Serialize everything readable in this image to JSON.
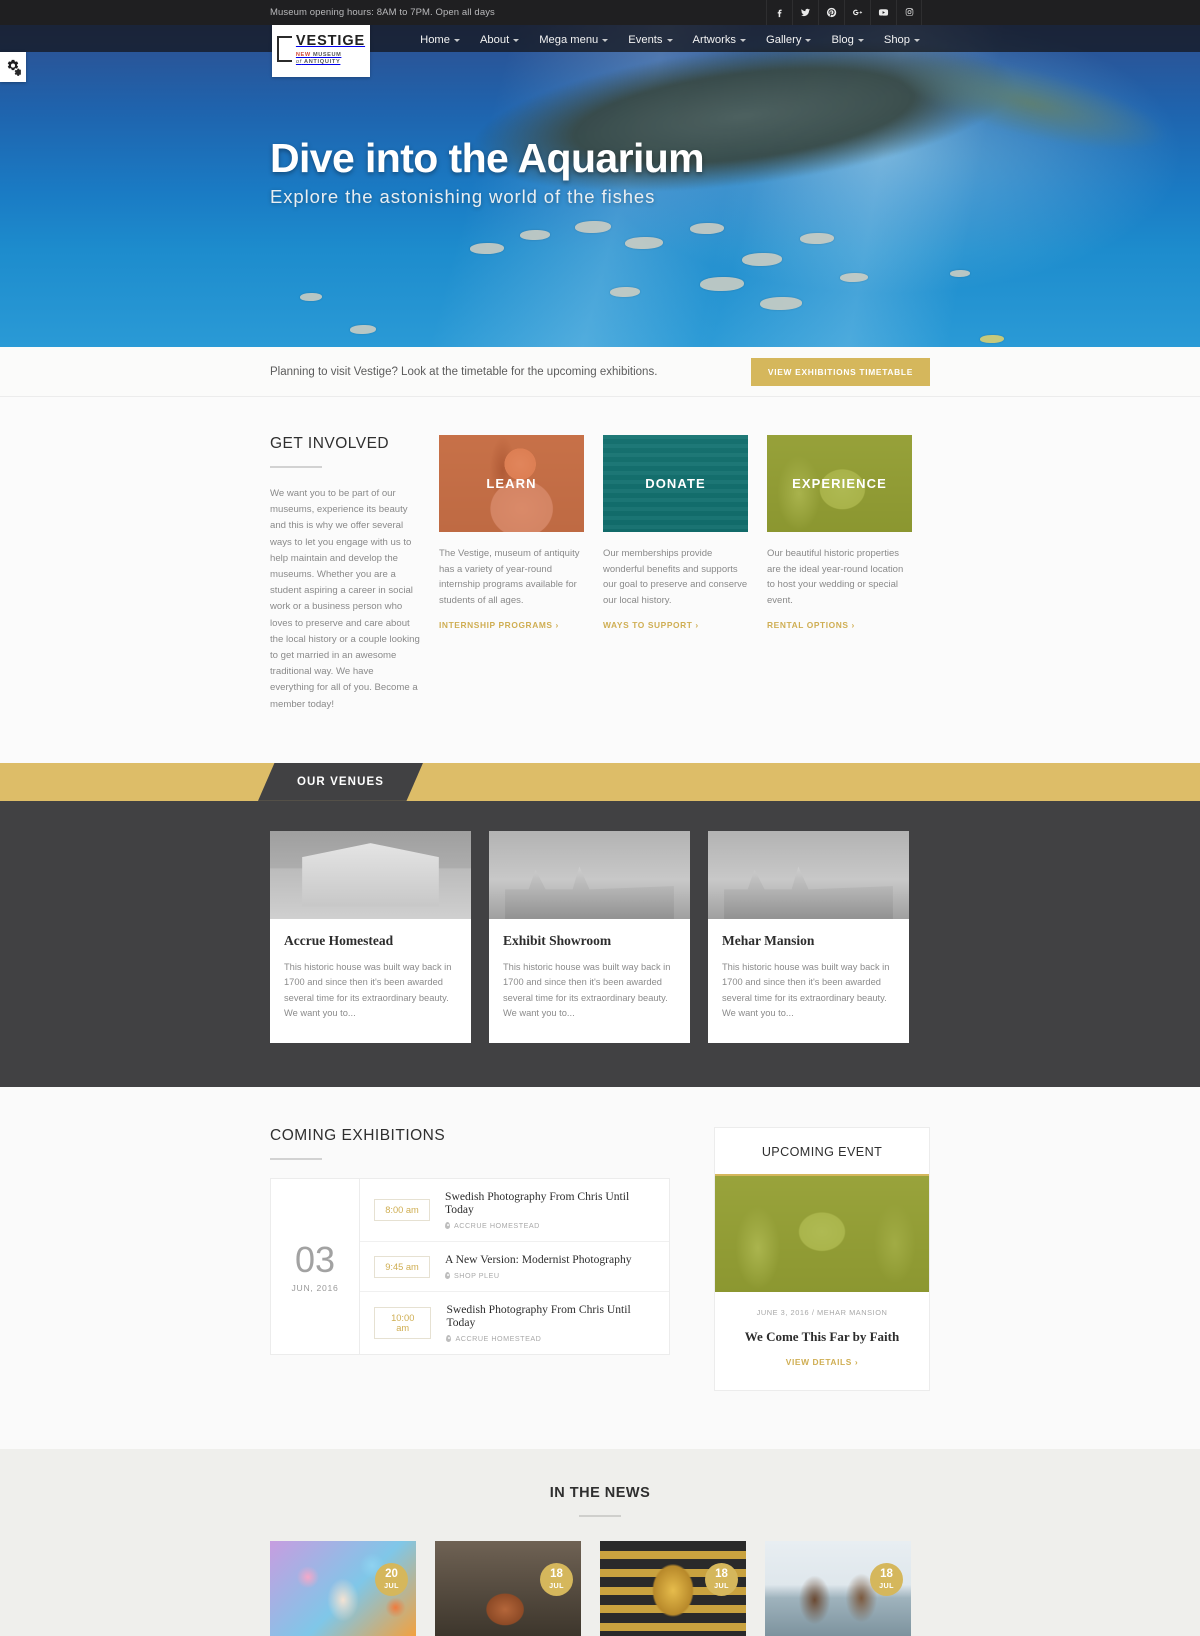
{
  "topbar": {
    "hours": "Museum opening hours: 8AM to 7PM. Open all days",
    "social": [
      {
        "name": "facebook-icon",
        "label": "Facebook"
      },
      {
        "name": "twitter-icon",
        "label": "Twitter"
      },
      {
        "name": "pinterest-icon",
        "label": "Pinterest"
      },
      {
        "name": "google-plus-icon",
        "label": "Google Plus"
      },
      {
        "name": "youtube-icon",
        "label": "YouTube"
      },
      {
        "name": "instagram-icon",
        "label": "Instagram"
      }
    ]
  },
  "logo": {
    "name": "VESTIGE",
    "tagline_new": "NEW",
    "tagline_museum": "MUSEUM",
    "tagline_of": "of",
    "tagline_antiquity": "ANTIQUITY"
  },
  "nav": {
    "items": [
      {
        "label": "Home",
        "caret": true
      },
      {
        "label": "About",
        "caret": true
      },
      {
        "label": "Mega menu",
        "caret": true
      },
      {
        "label": "Events",
        "caret": true
      },
      {
        "label": "Artworks",
        "caret": true
      },
      {
        "label": "Gallery",
        "caret": true
      },
      {
        "label": "Blog",
        "caret": true
      },
      {
        "label": "Shop",
        "caret": true
      }
    ]
  },
  "hero": {
    "title": "Dive into the Aquarium",
    "subtitle": "Explore the astonishing world of the fishes"
  },
  "notice": {
    "text": "Planning to visit Vestige? Look at the timetable for the upcoming exhibitions.",
    "button": "VIEW EXHIBITIONS TIMETABLE"
  },
  "get_involved": {
    "title": "GET INVOLVED",
    "intro": "We want you to be part of our museums, experience its beauty and this is why we offer several ways to let you engage with us to help maintain and develop the museums. Whether you are a student aspiring a career in social work or a business person who loves to preserve and care about the local history or a couple looking to get married in an awesome traditional way. We have everything for all of you. Become a member today!",
    "cards": [
      {
        "label": "LEARN",
        "text": "The Vestige, museum of antiquity has a variety of year-round internship programs available for students of all ages.",
        "link": "INTERNSHIP PROGRAMS ›",
        "color": "#de6e3f"
      },
      {
        "label": "DONATE",
        "text": "Our memberships provide wonderful benefits and supports our goal to preserve and conserve our local history.",
        "link": "WAYS TO SUPPORT ›",
        "color": "#0a7a7a"
      },
      {
        "label": "EXPERIENCE",
        "text": "Our beautiful historic properties are the ideal year-round location to host your wedding or special event.",
        "link": "RENTAL OPTIONS ›",
        "color": "#9aaa27"
      }
    ]
  },
  "venues": {
    "banner": "OUR VENUES",
    "cards": [
      {
        "title": "Accrue Homestead",
        "text": "This historic house was built way back in 1700 and since then it's been awarded several time for its extraordinary beauty. We want you to..."
      },
      {
        "title": "Exhibit Showroom",
        "text": "This historic house was built way back in 1700 and since then it's been awarded several time for its extraordinary beauty. We want you to..."
      },
      {
        "title": "Mehar Mansion",
        "text": "This historic house was built way back in 1700 and since then it's been awarded several time for its extraordinary beauty. We want you to..."
      }
    ]
  },
  "exhibitions": {
    "title": "COMING EXHIBITIONS",
    "date_day": "03",
    "date_month": "JUN, 2016",
    "rows": [
      {
        "time": "8:00 am",
        "title": "Swedish Photography From Chris Until Today",
        "location": "ACCRUE HOMESTEAD"
      },
      {
        "time": "9:45 am",
        "title": "A New Version: Modernist Photography",
        "location": "SHOP PLEU"
      },
      {
        "time": "10:00 am",
        "title": "Swedish Photography From Chris Until Today",
        "location": "ACCRUE HOMESTEAD"
      }
    ]
  },
  "upcoming": {
    "heading": "UPCOMING EVENT",
    "meta_date": "JUNE 3, 2016",
    "meta_sep": "/",
    "meta_venue": "MEHAR MANSION",
    "title": "We Come This Far by Faith",
    "link": "VIEW DETAILS ›"
  },
  "news": {
    "title": "IN THE NEWS",
    "cards": [
      {
        "day": "20",
        "month": "JUL"
      },
      {
        "day": "18",
        "month": "JUL"
      },
      {
        "day": "18",
        "month": "JUL"
      },
      {
        "day": "18",
        "month": "JUL"
      }
    ]
  },
  "colors": {
    "gold": "#d5b75c",
    "banner_gold": "#ddbd68",
    "dark": "#414143",
    "topbar": "#1f1f21"
  }
}
